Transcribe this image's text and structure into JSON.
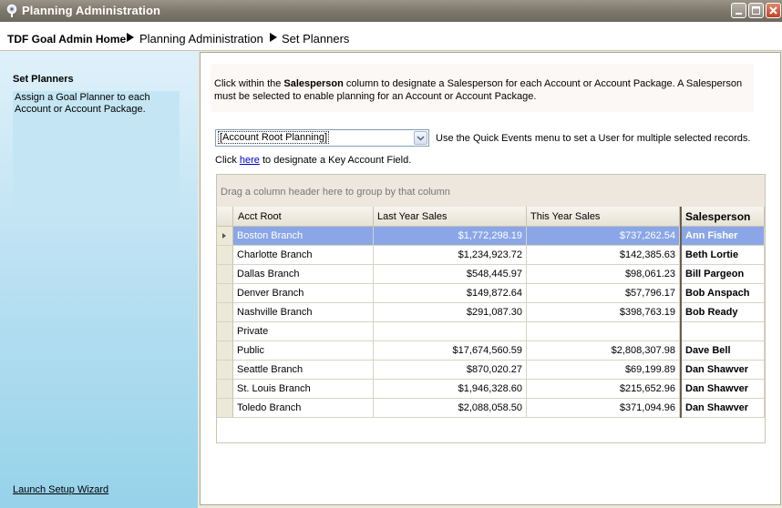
{
  "window": {
    "title": "Planning Administration"
  },
  "breadcrumb": [
    "TDF Goal Admin Home",
    "Planning Administration",
    "Set Planners"
  ],
  "sidebar": {
    "title": "Set Planners",
    "description": "Assign a Goal Planner to each Account or Account Package.",
    "wizard_link": "Launch Setup Wizard"
  },
  "main": {
    "instruction_prefix": "Click within the ",
    "instruction_bold": "Salesperson",
    "instruction_suffix": " column to designate a Salesperson for each Account or Account Package.  A Salesperson must be selected to enable planning for an Account or Account Package.",
    "combo_value": "[Account Root Planning]",
    "quick_events_hint": "Use the Quick Events menu to set a User for multiple selected records.",
    "key_prefix": "Click ",
    "key_link": "here",
    "key_suffix": " to designate a Key Account Field.",
    "group_hint": "Drag a column header here to group by that column"
  },
  "grid": {
    "columns": [
      "Acct Root",
      "Last Year Sales",
      "This Year Sales",
      "Salesperson"
    ],
    "rows": [
      {
        "acct": "Boston Branch",
        "last": "$1,772,298.19",
        "this": "$737,262.54",
        "sales": "Ann Fisher",
        "selected": true
      },
      {
        "acct": "Charlotte Branch",
        "last": "$1,234,923.72",
        "this": "$142,385.63",
        "sales": "Beth Lortie"
      },
      {
        "acct": "Dallas Branch",
        "last": "$548,445.97",
        "this": "$98,061.23",
        "sales": "Bill Pargeon"
      },
      {
        "acct": "Denver Branch",
        "last": "$149,872.64",
        "this": "$57,796.17",
        "sales": "Bob Anspach"
      },
      {
        "acct": "Nashville Branch",
        "last": "$291,087.30",
        "this": "$398,763.19",
        "sales": "Bob Ready"
      },
      {
        "acct": "Private",
        "last": "",
        "this": "",
        "sales": ""
      },
      {
        "acct": "Public",
        "last": "$17,674,560.59",
        "this": "$2,808,307.98",
        "sales": "Dave Bell"
      },
      {
        "acct": "Seattle Branch",
        "last": "$870,020.27",
        "this": "$69,199.89",
        "sales": "Dan Shawver"
      },
      {
        "acct": "St. Louis Branch",
        "last": "$1,946,328.60",
        "this": "$215,652.96",
        "sales": "Dan Shawver"
      },
      {
        "acct": "Toledo Branch",
        "last": "$2,088,058.50",
        "this": "$371,094.96",
        "sales": "Dan Shawver"
      }
    ]
  }
}
